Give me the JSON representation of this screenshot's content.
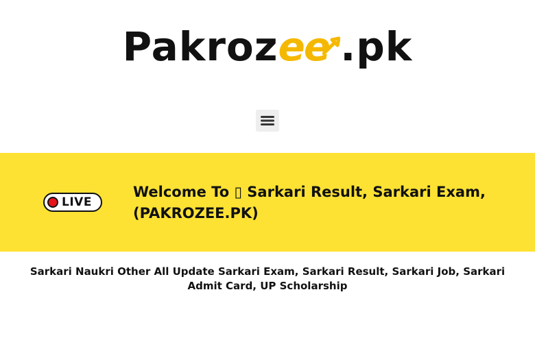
{
  "header": {
    "logo_prefix": "Pakroz",
    "logo_accent": "ee",
    "logo_suffix": ".pk"
  },
  "nav": {
    "menu_icon": "hamburger-menu-icon"
  },
  "banner": {
    "badge_label": "LIVE",
    "welcome_text": "Welcome To ▯ Sarkari Result, Sarkari Exam, (PAKROZEE.PK)"
  },
  "subheading": {
    "text": "Sarkari Naukri Other All Update Sarkari Exam, Sarkari Result, Sarkari Job, Sarkari Admit Card, UP Scholarship"
  },
  "colors": {
    "banner_bg": "#fde234",
    "logo_accent": "#f5b800",
    "live_dot": "#e8131b",
    "text": "#111111"
  }
}
